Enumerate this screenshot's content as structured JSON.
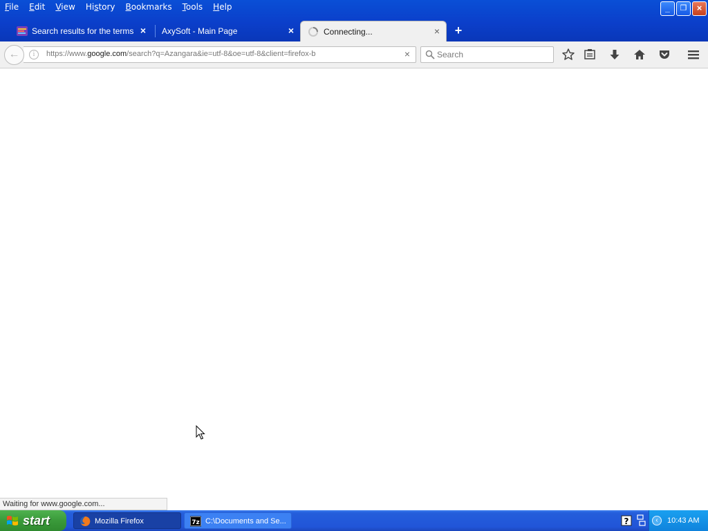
{
  "menu": [
    {
      "pre": "",
      "mn": "F",
      "post": "ile"
    },
    {
      "pre": "",
      "mn": "E",
      "post": "dit"
    },
    {
      "pre": "",
      "mn": "V",
      "post": "iew"
    },
    {
      "pre": "Hi",
      "mn": "s",
      "post": "tory"
    },
    {
      "pre": "",
      "mn": "B",
      "post": "ookmarks"
    },
    {
      "pre": "",
      "mn": "T",
      "post": "ools"
    },
    {
      "pre": "",
      "mn": "H",
      "post": "elp"
    }
  ],
  "tabs": [
    {
      "title": "Search results for the terms ...",
      "close": "×",
      "active": false
    },
    {
      "title": "AxySoft - Main Page",
      "close": "×",
      "active": false
    },
    {
      "title": "Connecting...",
      "close": "×",
      "active": true
    }
  ],
  "newtab": "+",
  "nav": {
    "back": "←",
    "info": "i",
    "url_prefix": "https://www.",
    "url_domain": "google.com",
    "url_rest": "/search?q=Azangara&ie=utf-8&oe=utf-8&client=firefox-b",
    "clear": "×",
    "search_placeholder": "Search",
    "search_value": ""
  },
  "window_buttons": {
    "minimize": "_",
    "restore": "❐",
    "close": "×"
  },
  "status": "Waiting for www.google.com...",
  "taskbar": {
    "start": "start",
    "tasks": [
      {
        "label": "Mozilla Firefox",
        "pressed": true,
        "icon": "firefox-icon"
      },
      {
        "label": "C:\\Documents and Se...",
        "pressed": false,
        "icon": "7zip-icon"
      }
    ],
    "clock": "10:43 AM"
  },
  "colors": {
    "titlebar_blue": "#0b3fca",
    "taskbar_blue": "#245edb",
    "start_green": "#3a9a3a",
    "toolbar_bg": "#f0f0f0"
  }
}
